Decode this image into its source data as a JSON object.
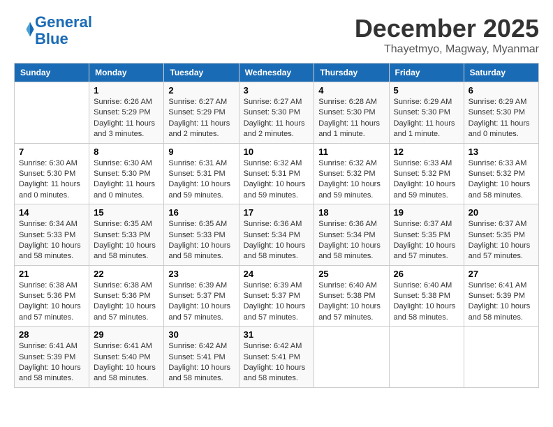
{
  "header": {
    "logo_line1": "General",
    "logo_line2": "Blue",
    "month": "December 2025",
    "location": "Thayetmyo, Magway, Myanmar"
  },
  "weekdays": [
    "Sunday",
    "Monday",
    "Tuesday",
    "Wednesday",
    "Thursday",
    "Friday",
    "Saturday"
  ],
  "weeks": [
    [
      {
        "day": "",
        "sunrise": "",
        "sunset": "",
        "daylight": ""
      },
      {
        "day": "1",
        "sunrise": "Sunrise: 6:26 AM",
        "sunset": "Sunset: 5:29 PM",
        "daylight": "Daylight: 11 hours and 3 minutes."
      },
      {
        "day": "2",
        "sunrise": "Sunrise: 6:27 AM",
        "sunset": "Sunset: 5:29 PM",
        "daylight": "Daylight: 11 hours and 2 minutes."
      },
      {
        "day": "3",
        "sunrise": "Sunrise: 6:27 AM",
        "sunset": "Sunset: 5:30 PM",
        "daylight": "Daylight: 11 hours and 2 minutes."
      },
      {
        "day": "4",
        "sunrise": "Sunrise: 6:28 AM",
        "sunset": "Sunset: 5:30 PM",
        "daylight": "Daylight: 11 hours and 1 minute."
      },
      {
        "day": "5",
        "sunrise": "Sunrise: 6:29 AM",
        "sunset": "Sunset: 5:30 PM",
        "daylight": "Daylight: 11 hours and 1 minute."
      },
      {
        "day": "6",
        "sunrise": "Sunrise: 6:29 AM",
        "sunset": "Sunset: 5:30 PM",
        "daylight": "Daylight: 11 hours and 0 minutes."
      }
    ],
    [
      {
        "day": "7",
        "sunrise": "Sunrise: 6:30 AM",
        "sunset": "Sunset: 5:30 PM",
        "daylight": "Daylight: 11 hours and 0 minutes."
      },
      {
        "day": "8",
        "sunrise": "Sunrise: 6:30 AM",
        "sunset": "Sunset: 5:30 PM",
        "daylight": "Daylight: 11 hours and 0 minutes."
      },
      {
        "day": "9",
        "sunrise": "Sunrise: 6:31 AM",
        "sunset": "Sunset: 5:31 PM",
        "daylight": "Daylight: 10 hours and 59 minutes."
      },
      {
        "day": "10",
        "sunrise": "Sunrise: 6:32 AM",
        "sunset": "Sunset: 5:31 PM",
        "daylight": "Daylight: 10 hours and 59 minutes."
      },
      {
        "day": "11",
        "sunrise": "Sunrise: 6:32 AM",
        "sunset": "Sunset: 5:32 PM",
        "daylight": "Daylight: 10 hours and 59 minutes."
      },
      {
        "day": "12",
        "sunrise": "Sunrise: 6:33 AM",
        "sunset": "Sunset: 5:32 PM",
        "daylight": "Daylight: 10 hours and 59 minutes."
      },
      {
        "day": "13",
        "sunrise": "Sunrise: 6:33 AM",
        "sunset": "Sunset: 5:32 PM",
        "daylight": "Daylight: 10 hours and 58 minutes."
      }
    ],
    [
      {
        "day": "14",
        "sunrise": "Sunrise: 6:34 AM",
        "sunset": "Sunset: 5:33 PM",
        "daylight": "Daylight: 10 hours and 58 minutes."
      },
      {
        "day": "15",
        "sunrise": "Sunrise: 6:35 AM",
        "sunset": "Sunset: 5:33 PM",
        "daylight": "Daylight: 10 hours and 58 minutes."
      },
      {
        "day": "16",
        "sunrise": "Sunrise: 6:35 AM",
        "sunset": "Sunset: 5:33 PM",
        "daylight": "Daylight: 10 hours and 58 minutes."
      },
      {
        "day": "17",
        "sunrise": "Sunrise: 6:36 AM",
        "sunset": "Sunset: 5:34 PM",
        "daylight": "Daylight: 10 hours and 58 minutes."
      },
      {
        "day": "18",
        "sunrise": "Sunrise: 6:36 AM",
        "sunset": "Sunset: 5:34 PM",
        "daylight": "Daylight: 10 hours and 58 minutes."
      },
      {
        "day": "19",
        "sunrise": "Sunrise: 6:37 AM",
        "sunset": "Sunset: 5:35 PM",
        "daylight": "Daylight: 10 hours and 57 minutes."
      },
      {
        "day": "20",
        "sunrise": "Sunrise: 6:37 AM",
        "sunset": "Sunset: 5:35 PM",
        "daylight": "Daylight: 10 hours and 57 minutes."
      }
    ],
    [
      {
        "day": "21",
        "sunrise": "Sunrise: 6:38 AM",
        "sunset": "Sunset: 5:36 PM",
        "daylight": "Daylight: 10 hours and 57 minutes."
      },
      {
        "day": "22",
        "sunrise": "Sunrise: 6:38 AM",
        "sunset": "Sunset: 5:36 PM",
        "daylight": "Daylight: 10 hours and 57 minutes."
      },
      {
        "day": "23",
        "sunrise": "Sunrise: 6:39 AM",
        "sunset": "Sunset: 5:37 PM",
        "daylight": "Daylight: 10 hours and 57 minutes."
      },
      {
        "day": "24",
        "sunrise": "Sunrise: 6:39 AM",
        "sunset": "Sunset: 5:37 PM",
        "daylight": "Daylight: 10 hours and 57 minutes."
      },
      {
        "day": "25",
        "sunrise": "Sunrise: 6:40 AM",
        "sunset": "Sunset: 5:38 PM",
        "daylight": "Daylight: 10 hours and 57 minutes."
      },
      {
        "day": "26",
        "sunrise": "Sunrise: 6:40 AM",
        "sunset": "Sunset: 5:38 PM",
        "daylight": "Daylight: 10 hours and 58 minutes."
      },
      {
        "day": "27",
        "sunrise": "Sunrise: 6:41 AM",
        "sunset": "Sunset: 5:39 PM",
        "daylight": "Daylight: 10 hours and 58 minutes."
      }
    ],
    [
      {
        "day": "28",
        "sunrise": "Sunrise: 6:41 AM",
        "sunset": "Sunset: 5:39 PM",
        "daylight": "Daylight: 10 hours and 58 minutes."
      },
      {
        "day": "29",
        "sunrise": "Sunrise: 6:41 AM",
        "sunset": "Sunset: 5:40 PM",
        "daylight": "Daylight: 10 hours and 58 minutes."
      },
      {
        "day": "30",
        "sunrise": "Sunrise: 6:42 AM",
        "sunset": "Sunset: 5:41 PM",
        "daylight": "Daylight: 10 hours and 58 minutes."
      },
      {
        "day": "31",
        "sunrise": "Sunrise: 6:42 AM",
        "sunset": "Sunset: 5:41 PM",
        "daylight": "Daylight: 10 hours and 58 minutes."
      },
      {
        "day": "",
        "sunrise": "",
        "sunset": "",
        "daylight": ""
      },
      {
        "day": "",
        "sunrise": "",
        "sunset": "",
        "daylight": ""
      },
      {
        "day": "",
        "sunrise": "",
        "sunset": "",
        "daylight": ""
      }
    ]
  ]
}
